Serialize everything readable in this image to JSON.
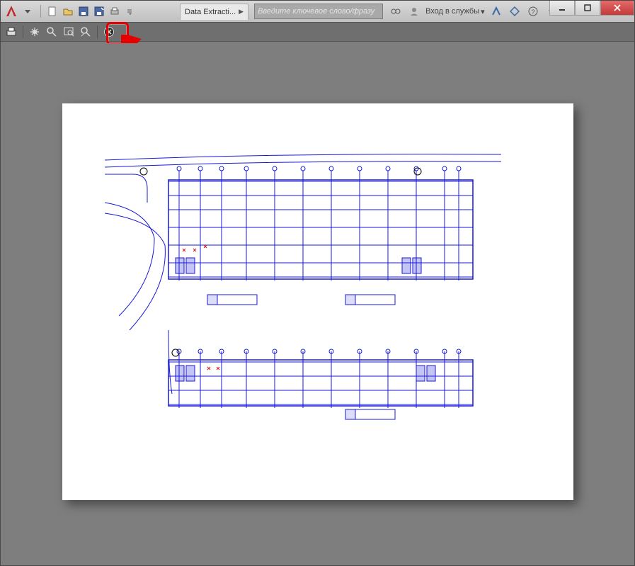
{
  "titlebar": {
    "document_title": "Data Extracti...",
    "search_placeholder": "Введите ключевое слово/фразу",
    "signin_label": "Вход в службы"
  },
  "icons": {
    "app": "autocad-logo",
    "qat": [
      "new-icon",
      "open-icon",
      "save-icon",
      "saveas-icon",
      "print-icon",
      "more-icon"
    ],
    "right": [
      "stayconnected-icon",
      "user-icon",
      "exchange-icon",
      "app-icon",
      "help-icon"
    ],
    "preview": [
      "plot-icon",
      "pan-icon",
      "zoom-icon",
      "zoom-window-icon",
      "zoom-previous-icon",
      "close-preview-icon"
    ],
    "window": [
      "minimize",
      "maximize",
      "close"
    ]
  },
  "annotations": {
    "highlight_target": "close-preview-button"
  }
}
